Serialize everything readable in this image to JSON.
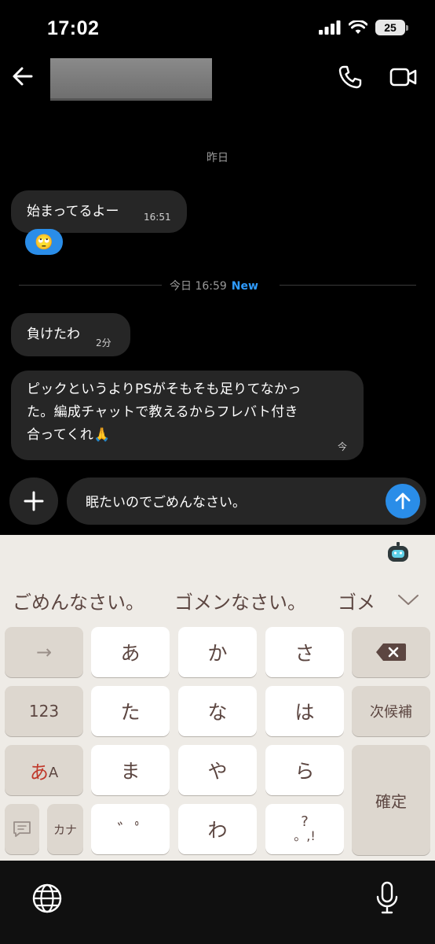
{
  "status": {
    "time": "17:02",
    "battery": "25"
  },
  "header": {
    "back_icon": "arrow-left-icon",
    "call_icon": "phone-icon",
    "video_icon": "video-camera-icon"
  },
  "messages": {
    "date_divider": "昨日",
    "m1": {
      "text": "始まってるよー",
      "time": "16:51",
      "reaction": "🙄"
    },
    "new_divider": {
      "label": "今日 16:59",
      "tag": "New"
    },
    "m2": {
      "text": "負けたわ",
      "time": "2分"
    },
    "m3": {
      "line1": "ピックというよりPSがそもそも足りてなかっ",
      "line2": "た。編成チャットで教えるからフレバト付き",
      "line3": "合ってくれ🙏",
      "time": "今"
    }
  },
  "composer": {
    "input_value": "眠たいのでごめんなさい。",
    "send_icon": "arrow-up-icon",
    "plus_icon": "plus-icon"
  },
  "keyboard": {
    "candidates": [
      "ごめんなさい。",
      "ゴメンなさい。",
      "ゴメ"
    ],
    "keys": {
      "arrow": "→",
      "a": "あ",
      "ka": "か",
      "sa": "さ",
      "delete_icon": "backspace-icon",
      "num": "123",
      "ta": "た",
      "na": "な",
      "ha": "は",
      "next": "次候補",
      "mode_a": "あ",
      "mode_b": "A",
      "ma": "ま",
      "ya": "や",
      "ra": "ら",
      "confirm": "確定",
      "kana": "カナ",
      "dakuten": "゛ﾟ",
      "wa": "わ",
      "punct_q": "?",
      "punct_rest": "。,!"
    }
  },
  "colors": {
    "accent": "#2a8de8",
    "new_tag": "#2f9cff",
    "bubble": "#262626",
    "keyboard_bg": "#eeebe6",
    "key_text": "#5c4641"
  }
}
